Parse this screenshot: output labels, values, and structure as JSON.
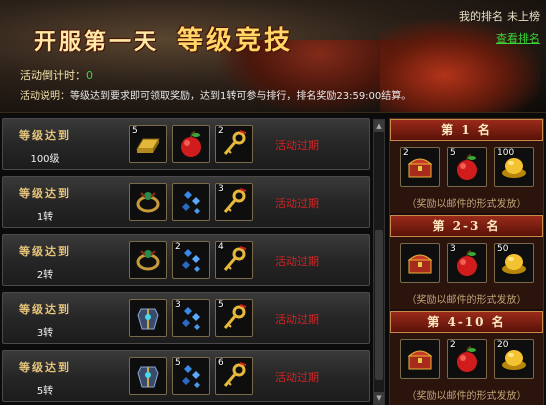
{
  "banner": {
    "title_prefix": "开服第一天",
    "title_main": "等级竞技",
    "rank_label": "我的排名",
    "rank_value": "未上榜",
    "rank_link": "查看排名",
    "countdown_label": "活动倒计时：",
    "countdown_value": "0",
    "desc_label": "活动说明：",
    "desc_text": "等级达到要求即可领取奖励，达到1转可参与排行，排名奖励23:59:00结算。"
  },
  "rows": [
    {
      "label": "等级达到",
      "level": "100级",
      "status": "活动过期",
      "items": [
        {
          "icon": "gold-bar-icon",
          "count": "5"
        },
        {
          "icon": "apple-icon",
          "count": ""
        },
        {
          "icon": "key-icon",
          "count": "2"
        }
      ]
    },
    {
      "label": "等级达到",
      "level": "1转",
      "status": "活动过期",
      "items": [
        {
          "icon": "ring-icon",
          "count": ""
        },
        {
          "icon": "blue-gems-icon",
          "count": ""
        },
        {
          "icon": "key-icon",
          "count": "3"
        }
      ]
    },
    {
      "label": "等级达到",
      "level": "2转",
      "status": "活动过期",
      "items": [
        {
          "icon": "ring-icon",
          "count": ""
        },
        {
          "icon": "blue-gems-icon",
          "count": "2"
        },
        {
          "icon": "key-icon",
          "count": "4"
        }
      ]
    },
    {
      "label": "等级达到",
      "level": "3转",
      "status": "活动过期",
      "items": [
        {
          "icon": "armor-icon",
          "count": ""
        },
        {
          "icon": "blue-gems-icon",
          "count": "3"
        },
        {
          "icon": "key-icon",
          "count": "5"
        }
      ]
    },
    {
      "label": "等级达到",
      "level": "5转",
      "status": "活动过期",
      "items": [
        {
          "icon": "armor-icon",
          "count": ""
        },
        {
          "icon": "blue-gems-icon",
          "count": "5"
        },
        {
          "icon": "key-icon",
          "count": "6"
        }
      ]
    }
  ],
  "tiers": [
    {
      "title": "第 1 名",
      "note": "（奖励以邮件的形式发放）",
      "items": [
        {
          "icon": "treasure-chest-icon",
          "count": "2"
        },
        {
          "icon": "apple-icon",
          "count": "5"
        },
        {
          "icon": "gold-ingot-icon",
          "count": "100"
        }
      ]
    },
    {
      "title": "第 2-3 名",
      "note": "（奖励以邮件的形式发放）",
      "items": [
        {
          "icon": "treasure-chest-icon",
          "count": ""
        },
        {
          "icon": "apple-icon",
          "count": "3"
        },
        {
          "icon": "gold-ingot-icon",
          "count": "50"
        }
      ]
    },
    {
      "title": "第 4-10 名",
      "note": "（奖励以邮件的形式发放）",
      "items": [
        {
          "icon": "treasure-chest-icon",
          "count": ""
        },
        {
          "icon": "apple-icon",
          "count": "2"
        },
        {
          "icon": "gold-ingot-icon",
          "count": "20"
        }
      ]
    }
  ],
  "colors": {
    "expired": "#d42424",
    "accent_gold": "#e6c47a",
    "link_green": "#39d639"
  }
}
